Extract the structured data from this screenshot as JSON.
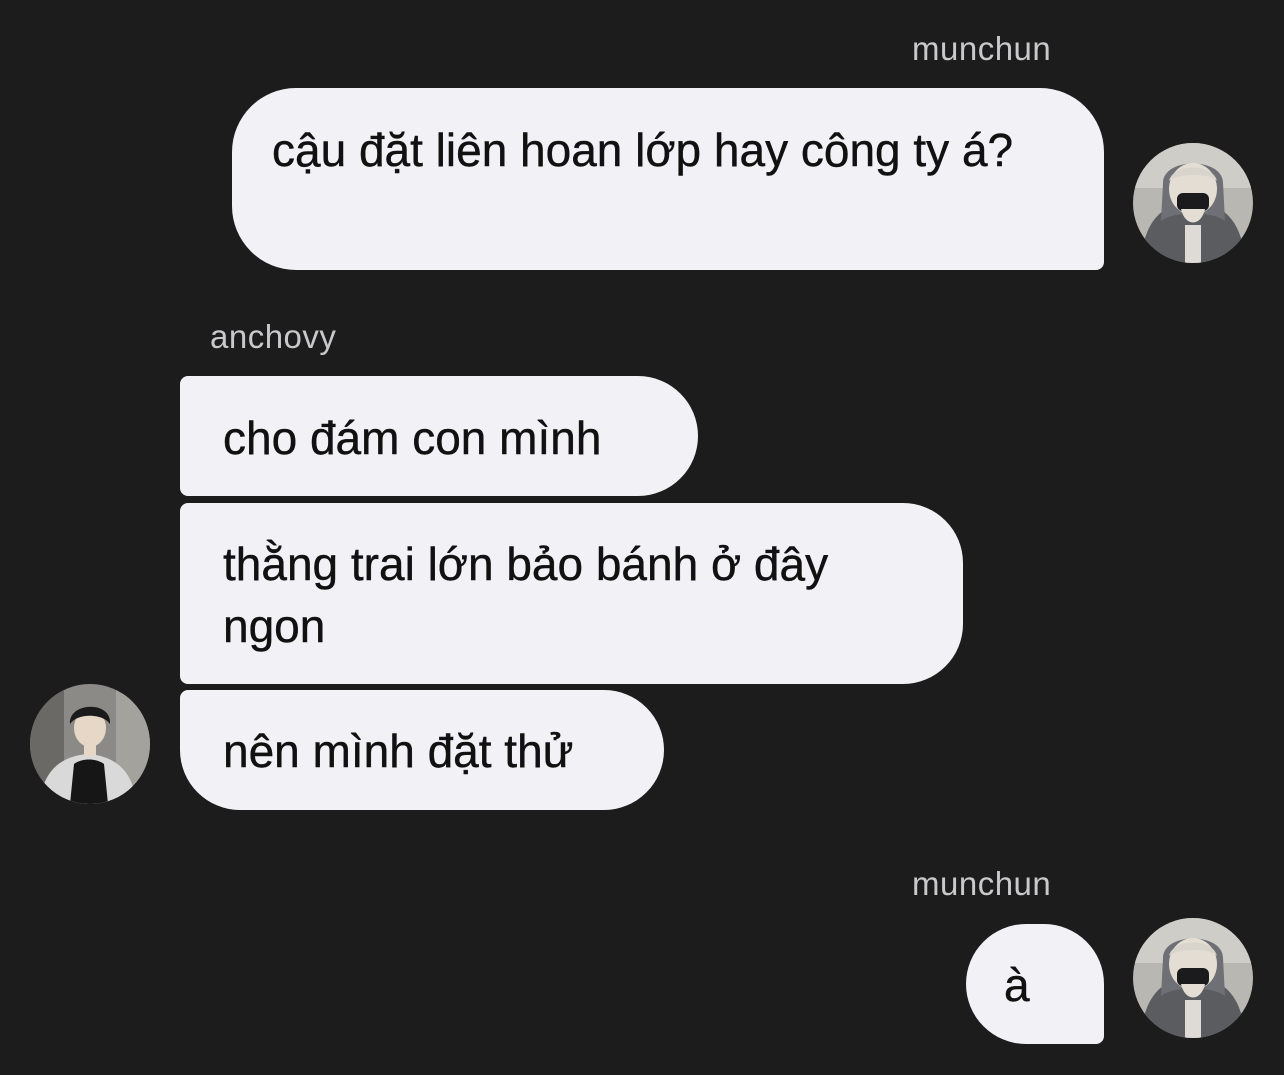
{
  "colors": {
    "background": "#1c1c1c",
    "bubble": "#f1f1f6",
    "bubble_text": "#111111",
    "sender_text": "#c9c9cc"
  },
  "messages": [
    {
      "sender": "munchun",
      "side": "right",
      "avatar_icon": "user-avatar-munchun-icon",
      "texts": [
        "cậu đặt liên hoan lớp hay công ty á?"
      ]
    },
    {
      "sender": "anchovy",
      "side": "left",
      "avatar_icon": "user-avatar-anchovy-icon",
      "texts": [
        "cho đám con mình",
        "thằng trai lớn bảo bánh ở đây ngon",
        "nên mình đặt thử"
      ]
    },
    {
      "sender": "munchun",
      "side": "right",
      "avatar_icon": "user-avatar-munchun-icon",
      "texts": [
        "à"
      ]
    }
  ]
}
